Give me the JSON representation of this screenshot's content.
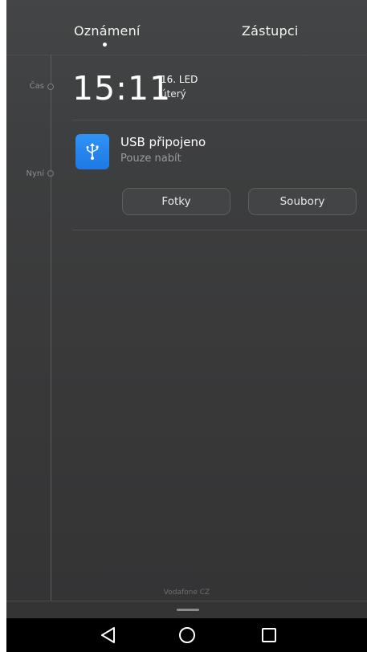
{
  "tabs": {
    "notifications": "Oznámení",
    "shortcuts": "Zástupci"
  },
  "timeline": {
    "time_label": "Čas",
    "now_label": "Nyní"
  },
  "clock": {
    "time": "15:11",
    "date": "16. LED",
    "weekday": "úterý"
  },
  "usb_notification": {
    "icon": "usb-icon",
    "title": "USB připojeno",
    "subtitle": "Pouze nabít",
    "buttons": {
      "photos": "Fotky",
      "files": "Soubory"
    }
  },
  "footer": {
    "carrier": "Vodafone CZ"
  },
  "colors": {
    "accent_blue": "#2187ee",
    "background": "#3d3e3f"
  },
  "navbar": {
    "icons": [
      "back-icon",
      "home-icon",
      "recents-icon"
    ]
  }
}
